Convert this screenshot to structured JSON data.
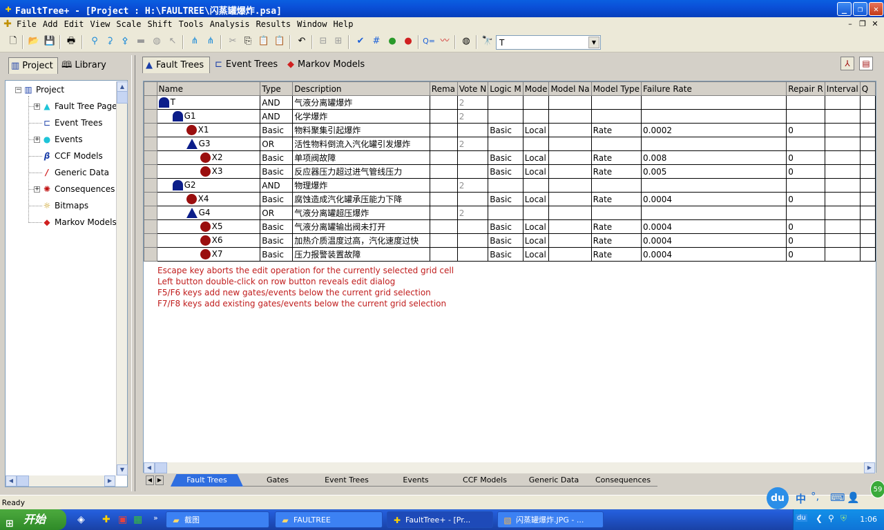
{
  "window": {
    "title": "FaultTree+ - [Project : H:\\FAULTREE\\闪蒸罐爆炸.psa]",
    "icon": "faulttree-app-icon"
  },
  "menu": {
    "items": [
      "File",
      "Add",
      "Edit",
      "View",
      "Scale",
      "Shift",
      "Tools",
      "Analysis",
      "Results",
      "Window",
      "Help"
    ]
  },
  "toolbar": {
    "find_value": "T"
  },
  "left_pane": {
    "tabs": [
      "Project",
      "Library"
    ],
    "tree": [
      {
        "label": "Project",
        "icon": "project-icon"
      },
      {
        "label": "Fault Tree Pages",
        "icon": "fault-tree-pages-icon"
      },
      {
        "label": "Event Trees",
        "icon": "event-trees-icon"
      },
      {
        "label": "Events",
        "icon": "events-icon"
      },
      {
        "label": "CCF Models",
        "icon": "ccf-models-icon"
      },
      {
        "label": "Generic Data",
        "icon": "generic-data-icon"
      },
      {
        "label": "Consequences",
        "icon": "consequences-icon"
      },
      {
        "label": "Bitmaps",
        "icon": "bitmaps-icon"
      },
      {
        "label": "Markov Models",
        "icon": "markov-models-icon"
      }
    ]
  },
  "right_pane": {
    "tabs": [
      "Fault Trees",
      "Event Trees",
      "Markov Models"
    ]
  },
  "grid": {
    "columns": [
      "Name",
      "Type",
      "Description",
      "Rema",
      "Vote N",
      "Logic M",
      "Mode",
      "Model Na",
      "Model Type",
      "Failure Rate",
      "Repair R",
      "Interval",
      "Q"
    ],
    "rows": [
      {
        "name": "T",
        "kind": "and-gate",
        "indent": 0,
        "type": "AND",
        "description": "气液分离罐爆炸",
        "vote": "2",
        "logic": "",
        "mode": "",
        "model_type": "",
        "failure_rate": "",
        "repair": ""
      },
      {
        "name": "G1",
        "kind": "and-gate",
        "indent": 1,
        "type": "AND",
        "description": "化学爆炸",
        "vote": "2",
        "logic": "",
        "mode": "",
        "model_type": "",
        "failure_rate": "",
        "repair": ""
      },
      {
        "name": "X1",
        "kind": "event",
        "indent": 2,
        "type": "Basic",
        "description": "物料聚集引起爆炸",
        "vote": "",
        "logic": "Basic",
        "mode": "Local",
        "model_type": "Rate",
        "failure_rate": "0.0002",
        "repair": "0"
      },
      {
        "name": "G3",
        "kind": "or-gate",
        "indent": 2,
        "type": "OR",
        "description": "活性物料倒流入汽化罐引发爆炸",
        "vote": "2",
        "logic": "",
        "mode": "",
        "model_type": "",
        "failure_rate": "",
        "repair": ""
      },
      {
        "name": "X2",
        "kind": "event",
        "indent": 3,
        "type": "Basic",
        "description": "单项阀故障",
        "vote": "",
        "logic": "Basic",
        "mode": "Local",
        "model_type": "Rate",
        "failure_rate": "0.008",
        "repair": "0"
      },
      {
        "name": "X3",
        "kind": "event",
        "indent": 3,
        "type": "Basic",
        "description": "反应器压力超过进气管线压力",
        "vote": "",
        "logic": "Basic",
        "mode": "Local",
        "model_type": "Rate",
        "failure_rate": "0.005",
        "repair": "0"
      },
      {
        "name": "G2",
        "kind": "and-gate",
        "indent": 1,
        "type": "AND",
        "description": "物理爆炸",
        "vote": "2",
        "logic": "",
        "mode": "",
        "model_type": "",
        "failure_rate": "",
        "repair": ""
      },
      {
        "name": "X4",
        "kind": "event",
        "indent": 2,
        "type": "Basic",
        "description": "腐蚀造成汽化罐承压能力下降",
        "vote": "",
        "logic": "Basic",
        "mode": "Local",
        "model_type": "Rate",
        "failure_rate": "0.0004",
        "repair": "0"
      },
      {
        "name": "G4",
        "kind": "or-gate",
        "indent": 2,
        "type": "OR",
        "description": "气液分离罐超压爆炸",
        "vote": "2",
        "logic": "",
        "mode": "",
        "model_type": "",
        "failure_rate": "",
        "repair": ""
      },
      {
        "name": "X5",
        "kind": "event",
        "indent": 3,
        "type": "Basic",
        "description": "气液分离罐输出阀未打开",
        "vote": "",
        "logic": "Basic",
        "mode": "Local",
        "model_type": "Rate",
        "failure_rate": "0.0004",
        "repair": "0"
      },
      {
        "name": "X6",
        "kind": "event",
        "indent": 3,
        "type": "Basic",
        "description": "加热介质温度过高，汽化速度过快",
        "vote": "",
        "logic": "Basic",
        "mode": "Local",
        "model_type": "Rate",
        "failure_rate": "0.0004",
        "repair": "0"
      },
      {
        "name": "X7",
        "kind": "event",
        "indent": 3,
        "type": "Basic",
        "description": "压力报警装置故障",
        "vote": "",
        "logic": "Basic",
        "mode": "Local",
        "model_type": "Rate",
        "failure_rate": "0.0004",
        "repair": "0"
      }
    ],
    "help_messages": [
      "Escape key aborts the edit operation for the currently selected grid cell",
      "Left button double-click on row button reveals edit dialog",
      "F5/F6 keys add new gates/events below the current grid selection",
      "F7/F8 keys add existing gates/events below the current grid selection"
    ]
  },
  "sheet_tabs": [
    "Fault Trees",
    "Gates",
    "Event Trees",
    "Events",
    "CCF Models",
    "Generic Data",
    "Consequences"
  ],
  "active_sheet": "Fault Trees",
  "status": "Ready",
  "taskbar": {
    "start_label": "开始",
    "tasks": [
      "截图",
      "FAULTREE",
      "FaultTree+ - [Pr...",
      "闪蒸罐爆炸.JPG - ..."
    ],
    "clock": "1:06",
    "ime_label": "中",
    "badge": "59"
  },
  "colors": {
    "titlebar": "#0a50d8",
    "gate": "#0c1e8a",
    "event": "#9a0e0e",
    "help_text": "#c01c1c",
    "active_sheet_tab": "#2f6ee0"
  }
}
